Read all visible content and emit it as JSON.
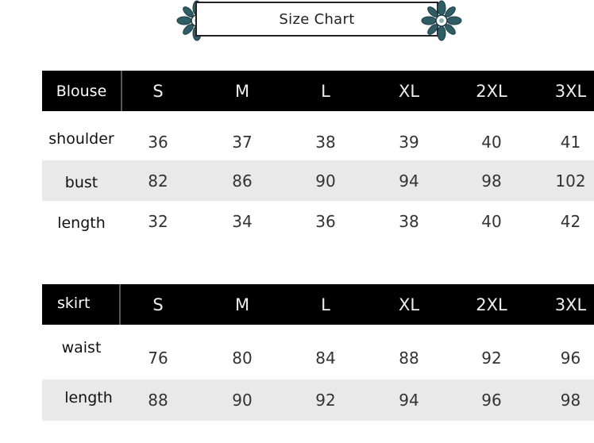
{
  "title": "Size Chart",
  "ornament_icon": "flower-ornament",
  "colors": {
    "header_bg": "#000000",
    "header_text": "#ffffff",
    "shade_row": "#e9e9e9",
    "ornament": "#2f5d66"
  },
  "blouse": {
    "name": "Blouse",
    "sizes": [
      "S",
      "M",
      "L",
      "XL",
      "2XL",
      "3XL"
    ],
    "rows": [
      {
        "label": "shoulder",
        "values": [
          "36",
          "37",
          "38",
          "39",
          "40",
          "41"
        ]
      },
      {
        "label": "bust",
        "values": [
          "82",
          "86",
          "90",
          "94",
          "98",
          "102"
        ]
      },
      {
        "label": "length",
        "values": [
          "32",
          "34",
          "36",
          "38",
          "40",
          "42"
        ]
      }
    ]
  },
  "skirt": {
    "name": "skirt",
    "sizes": [
      "S",
      "M",
      "L",
      "XL",
      "2XL",
      "3XL"
    ],
    "rows": [
      {
        "label": "waist",
        "values": [
          "76",
          "80",
          "84",
          "88",
          "92",
          "96"
        ]
      },
      {
        "label": "length",
        "values": [
          "88",
          "90",
          "92",
          "94",
          "96",
          "98"
        ]
      }
    ]
  }
}
